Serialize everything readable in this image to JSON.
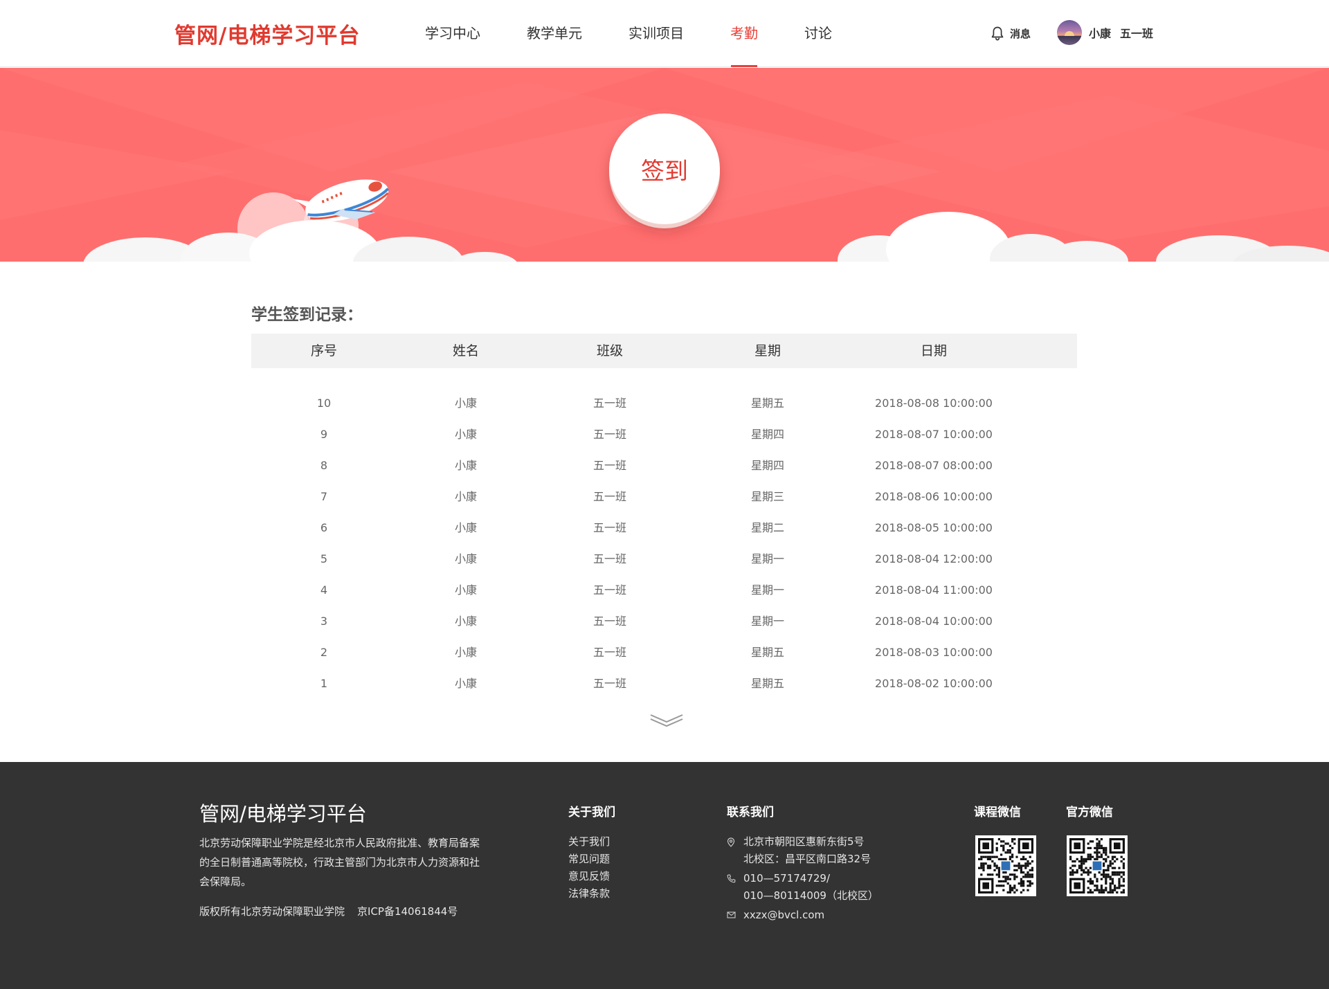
{
  "header": {
    "logo": "管网/电梯学习平台",
    "nav": [
      {
        "label": "学习中心",
        "active": false
      },
      {
        "label": "教学单元",
        "active": false
      },
      {
        "label": "实训项目",
        "active": false
      },
      {
        "label": "考勤",
        "active": true
      },
      {
        "label": "讨论",
        "active": false
      }
    ],
    "messages_label": "消息",
    "user_name": "小康",
    "user_class": "五一班"
  },
  "banner": {
    "sign_label": "签到",
    "color": "#ff6e6e"
  },
  "records": {
    "title": "学生签到记录：",
    "columns": [
      "序号",
      "姓名",
      "班级",
      "星期",
      "日期"
    ],
    "rows": [
      [
        "10",
        "小康",
        "五一班",
        "星期五",
        "2018-08-08 10:00:00"
      ],
      [
        "9",
        "小康",
        "五一班",
        "星期四",
        "2018-08-07 10:00:00"
      ],
      [
        "8",
        "小康",
        "五一班",
        "星期四",
        "2018-08-07 08:00:00"
      ],
      [
        "7",
        "小康",
        "五一班",
        "星期三",
        "2018-08-06 10:00:00"
      ],
      [
        "6",
        "小康",
        "五一班",
        "星期二",
        "2018-08-05 10:00:00"
      ],
      [
        "5",
        "小康",
        "五一班",
        "星期一",
        "2018-08-04 12:00:00"
      ],
      [
        "4",
        "小康",
        "五一班",
        "星期一",
        "2018-08-04 11:00:00"
      ],
      [
        "3",
        "小康",
        "五一班",
        "星期一",
        "2018-08-04 10:00:00"
      ],
      [
        "2",
        "小康",
        "五一班",
        "星期五",
        "2018-08-03 10:00:00"
      ],
      [
        "1",
        "小康",
        "五一班",
        "星期五",
        "2018-08-02 10:00:00"
      ]
    ]
  },
  "footer": {
    "brand": "管网/电梯学习平台",
    "description": "北京劳动保障职业学院是经北京市人民政府批准、教育局备案的全日制普通高等院校，行政主管部门为北京市人力资源和社会保障局。",
    "copyright": "版权所有北京劳动保障职业学院",
    "icp": "京ICP备14061844号",
    "about_title": "关于我们",
    "about_links": [
      "关于我们",
      "常见问题",
      "意见反馈",
      "法律条款"
    ],
    "contact_title": "联系我们",
    "address_1": "北京市朝阳区惠新东街5号",
    "address_2": "北校区：昌平区南口路32号",
    "phone_1": "010—57174729/",
    "phone_2": "010—80114009（北校区）",
    "email": "xxzx@bvcl.com",
    "qr_course_title": "课程微信",
    "qr_official_title": "官方微信"
  }
}
